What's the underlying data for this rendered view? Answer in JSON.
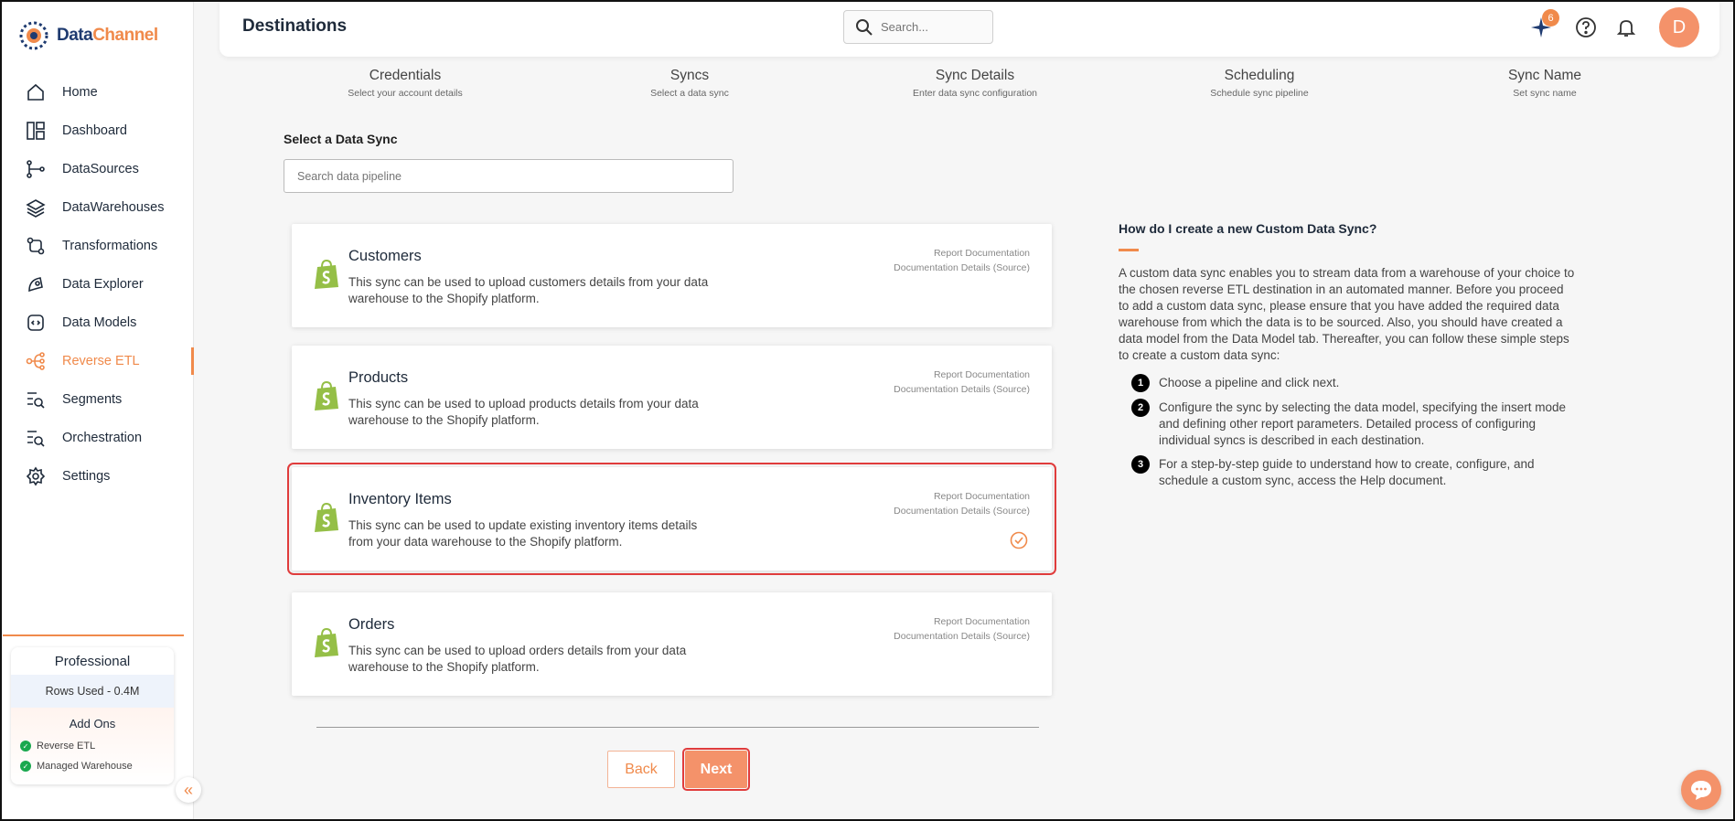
{
  "brand": {
    "name_part1": "Data",
    "name_part2": "Channel"
  },
  "sidebar": {
    "items": [
      {
        "label": "Home",
        "icon": "home-icon"
      },
      {
        "label": "Dashboard",
        "icon": "dashboard-icon"
      },
      {
        "label": "DataSources",
        "icon": "datasources-icon"
      },
      {
        "label": "DataWarehouses",
        "icon": "layers-icon"
      },
      {
        "label": "Transformations",
        "icon": "transform-icon"
      },
      {
        "label": "Data Explorer",
        "icon": "explorer-icon"
      },
      {
        "label": "Data Models",
        "icon": "models-icon"
      },
      {
        "label": "Reverse ETL",
        "icon": "reverse-etl-icon",
        "active": true
      },
      {
        "label": "Segments",
        "icon": "segments-icon"
      },
      {
        "label": "Orchestration",
        "icon": "orchestration-icon"
      },
      {
        "label": "Settings",
        "icon": "gear-icon"
      }
    ],
    "plan": {
      "title": "Professional",
      "rows_used": "Rows Used - 0.4M",
      "addons_heading": "Add Ons",
      "addons": [
        "Reverse ETL",
        "Managed Warehouse"
      ]
    }
  },
  "header": {
    "title": "Destinations",
    "search_placeholder": "Search...",
    "notification_count": "6",
    "avatar_initial": "D"
  },
  "steps": [
    {
      "title": "Credentials",
      "subtitle": "Select your account details"
    },
    {
      "title": "Syncs",
      "subtitle": "Select a data sync"
    },
    {
      "title": "Sync Details",
      "subtitle": "Enter data sync configuration"
    },
    {
      "title": "Scheduling",
      "subtitle": "Schedule sync pipeline"
    },
    {
      "title": "Sync Name",
      "subtitle": "Set sync name"
    }
  ],
  "main": {
    "section_label": "Select a Data Sync",
    "search_placeholder": "Search data pipeline",
    "link_report": "Report Documentation",
    "link_details": "Documentation Details (Source)",
    "syncs": [
      {
        "name": "Customers",
        "description": "This sync can be used to upload customers details from your data warehouse to the Shopify platform.",
        "selected": false
      },
      {
        "name": "Products",
        "description": "This sync can be used to upload products details from your data warehouse to the Shopify platform.",
        "selected": false
      },
      {
        "name": "Inventory Items",
        "description": "This sync can be used to update existing inventory items details from your data warehouse to the Shopify platform.",
        "selected": true
      },
      {
        "name": "Orders",
        "description": "This sync can be used to upload orders details from your data warehouse to the Shopify platform.",
        "selected": false
      }
    ],
    "back_label": "Back",
    "next_label": "Next"
  },
  "help": {
    "title": "How do I create a new Custom Data Sync?",
    "intro": "A custom data sync enables you to stream data from a warehouse of your choice to the chosen reverse ETL destination in an automated manner. Before you proceed to add a custom data sync, please ensure that you have added the required data warehouse from which the data is to be sourced. Also, you should have created a data model from the Data Model tab. Thereafter, you can follow these simple steps to create a custom data sync:",
    "steps": [
      {
        "num": "1",
        "text": "Choose a pipeline and click next."
      },
      {
        "num": "2",
        "text": "Configure the sync by selecting the data model, specifying the insert mode and defining other report parameters. Detailed process of configuring individual syncs is described in each destination."
      },
      {
        "num": "3",
        "text": "For a step-by-step guide to understand how to create, configure, and schedule a custom sync, access the Help document."
      }
    ]
  },
  "colors": {
    "accent": "#f08a4b",
    "selected_outline": "#e03c3c",
    "shopify_green": "#95bf47"
  }
}
